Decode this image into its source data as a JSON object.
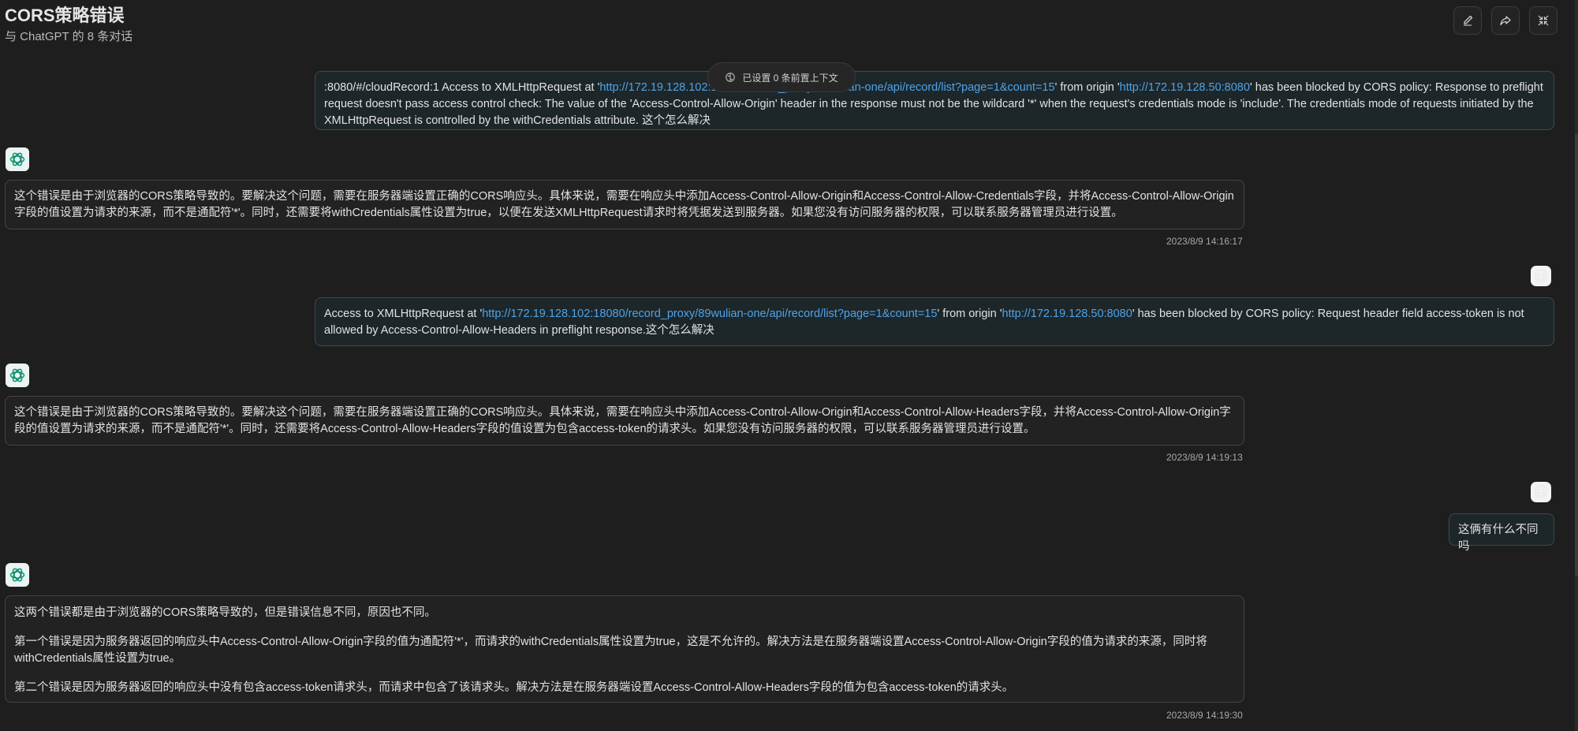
{
  "header": {
    "title": "CORS策略错误",
    "subtitle": "与 ChatGPT 的 8 条对话"
  },
  "context_pill": "已设置 0 条前置上下文",
  "messages": [
    {
      "role": "user",
      "segments": [
        {
          "type": "text",
          "value": ":8080/#/cloudRecord:1 Access to XMLHttpRequest at '"
        },
        {
          "type": "link",
          "value": "http://172.19.128.102:18080/record_proxy/89wulian-one/api/record/list?page=1&count=15"
        },
        {
          "type": "text",
          "value": "' from origin '"
        },
        {
          "type": "link",
          "value": "http://172.19.128.50:8080"
        },
        {
          "type": "text",
          "value": "' has been blocked by CORS policy: Response to preflight request doesn't pass access control check: The value of the 'Access-Control-Allow-Origin' header in the response must not be the wildcard '*' when the request's credentials mode is 'include'. The credentials mode of requests initiated by the XMLHttpRequest is controlled by the withCredentials attribute. 这个怎么解决"
        }
      ]
    },
    {
      "role": "assistant",
      "paragraphs": [
        "这个错误是由于浏览器的CORS策略导致的。要解决这个问题，需要在服务器端设置正确的CORS响应头。具体来说，需要在响应头中添加Access-Control-Allow-Origin和Access-Control-Allow-Credentials字段，并将Access-Control-Allow-Origin字段的值设置为请求的来源，而不是通配符'*'。同时，还需要将withCredentials属性设置为true，以便在发送XMLHttpRequest请求时将凭据发送到服务器。如果您没有访问服务器的权限，可以联系服务器管理员进行设置。"
      ],
      "timestamp": "2023/8/9 14:16:17"
    },
    {
      "role": "user",
      "avatar": "😃",
      "segments": [
        {
          "type": "text",
          "value": "Access to XMLHttpRequest at '"
        },
        {
          "type": "link",
          "value": "http://172.19.128.102:18080/record_proxy/89wulian-one/api/record/list?page=1&count=15"
        },
        {
          "type": "text",
          "value": "' from origin '"
        },
        {
          "type": "link",
          "value": "http://172.19.128.50:8080"
        },
        {
          "type": "text",
          "value": "' has been blocked by CORS policy: Request header field access-token is not allowed by Access-Control-Allow-Headers in preflight response.这个怎么解决"
        }
      ]
    },
    {
      "role": "assistant",
      "paragraphs": [
        "这个错误是由于浏览器的CORS策略导致的。要解决这个问题，需要在服务器端设置正确的CORS响应头。具体来说，需要在响应头中添加Access-Control-Allow-Origin和Access-Control-Allow-Headers字段，并将Access-Control-Allow-Origin字段的值设置为请求的来源，而不是通配符'*'。同时，还需要将Access-Control-Allow-Headers字段的值设置为包含access-token的请求头。如果您没有访问服务器的权限，可以联系服务器管理员进行设置。"
      ],
      "timestamp": "2023/8/9 14:19:13"
    },
    {
      "role": "user",
      "avatar": "😃",
      "segments": [
        {
          "type": "text",
          "value": "这俩有什么不同吗"
        }
      ]
    },
    {
      "role": "assistant",
      "paragraphs": [
        "这两个错误都是由于浏览器的CORS策略导致的，但是错误信息不同，原因也不同。",
        "第一个错误是因为服务器返回的响应头中Access-Control-Allow-Origin字段的值为通配符'*'，而请求的withCredentials属性设置为true，这是不允许的。解决方法是在服务器端设置Access-Control-Allow-Origin字段的值为请求的来源，同时将withCredentials属性设置为true。",
        "第二个错误是因为服务器返回的响应头中没有包含access-token请求头，而请求中包含了该请求头。解决方法是在服务器端设置Access-Control-Allow-Headers字段的值为包含access-token的请求头。"
      ],
      "timestamp": "2023/8/9 14:19:30"
    }
  ],
  "icons": {
    "edit": "pencil-icon",
    "share": "share-icon",
    "fullscreen": "collapse-icon",
    "assistant_avatar": "openai-logo-icon",
    "context": "brain-icon"
  },
  "colors": {
    "link": "#4fa3e8",
    "background": "#1e1e1e",
    "user_bubble": "#1d2629"
  }
}
